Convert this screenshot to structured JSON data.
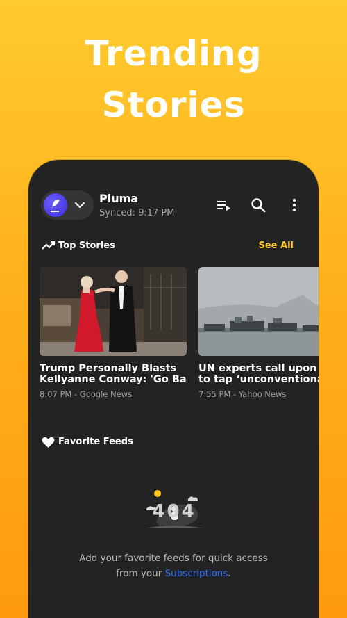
{
  "promo": {
    "title_line1": "Trending",
    "title_line2": "Stories"
  },
  "toolbar": {
    "app_name": "Pluma",
    "sync_status": "Synced: 9:17 PM",
    "icons": [
      "playlist-icon",
      "search-icon",
      "more-vert-icon"
    ]
  },
  "top_stories": {
    "title": "Top Stories",
    "see_all": "See All",
    "items": [
      {
        "title_line1": "Trump Personally Blasts",
        "title_line2": "Kellyanne Conway: 'Go Bac…",
        "meta": "8:07 PM - Google News"
      },
      {
        "title_line1": "UN experts call upon nat",
        "title_line2": "to tap ‘unconventional w",
        "meta": "7:55 PM - Yahoo News"
      }
    ]
  },
  "favorite_feeds": {
    "title": "Favorite Feeds",
    "empty_illustration_text": "404",
    "empty_text_line1": "Add your favorite feeds for quick access",
    "empty_text_prefix": "from your",
    "empty_link": "Subscriptions",
    "empty_text_suffix": "."
  },
  "colors": {
    "accent": "#FFC61E",
    "link": "#2f6dff",
    "background": "#232323"
  }
}
